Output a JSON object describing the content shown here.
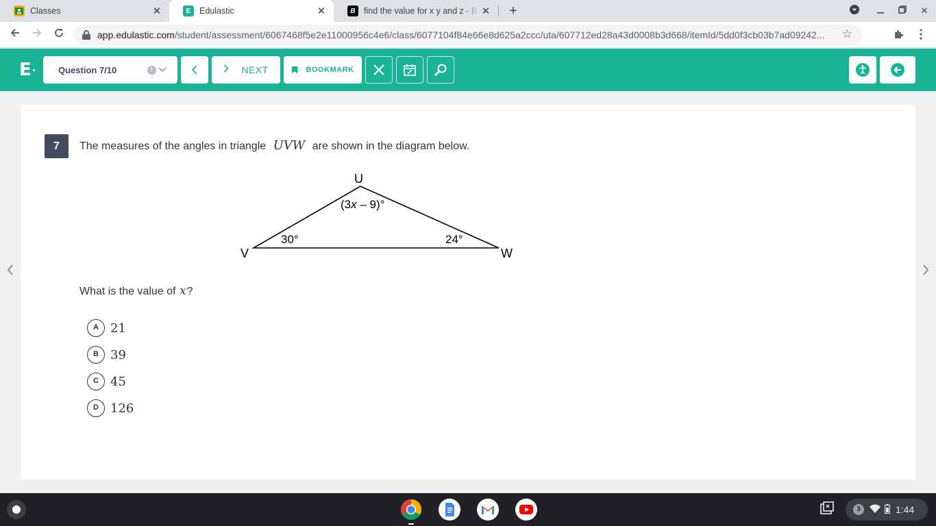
{
  "browser": {
    "tabs": [
      {
        "title": "Classes",
        "icon": "google-classroom-icon",
        "active": false
      },
      {
        "title": "Edulastic",
        "icon": "edulastic-icon",
        "active": true
      },
      {
        "title": "find the value for x y and z - Brainly",
        "icon": "brainly-icon",
        "active": false
      }
    ],
    "url_host": "app.edulastic.com",
    "url_path": "/student/assessment/6067468f5e2e11000956c4e6/class/6077104f84e66e8d625a2ccc/uta/607712ed28a43d0008b3d668/itemId/5dd0f3cb03b7ad09242..."
  },
  "header": {
    "logo": "E",
    "question_selector": "Question 7/10",
    "next_label": "NEXT",
    "bookmark_label": "BOOKMARK",
    "accent_color": "#1ab395"
  },
  "question": {
    "number": "7",
    "text_before": "The measures of the angles in triangle",
    "triangle_name": "UVW",
    "text_after": "are shown in the diagram below.",
    "prompt_before": "What is the value of",
    "prompt_var": "x",
    "prompt_after": "?"
  },
  "diagram": {
    "vertex_u": "U",
    "vertex_v": "V",
    "vertex_w": "W",
    "angle_u_open": "(3",
    "angle_u_var": "x",
    "angle_u_close": " – 9)°",
    "angle_v": "30°",
    "angle_w": "24°"
  },
  "choices": [
    {
      "letter": "A",
      "value": "21"
    },
    {
      "letter": "B",
      "value": "39"
    },
    {
      "letter": "C",
      "value": "45"
    },
    {
      "letter": "D",
      "value": "126"
    }
  ],
  "shelf": {
    "notification_count": "3",
    "time": "1:44"
  }
}
